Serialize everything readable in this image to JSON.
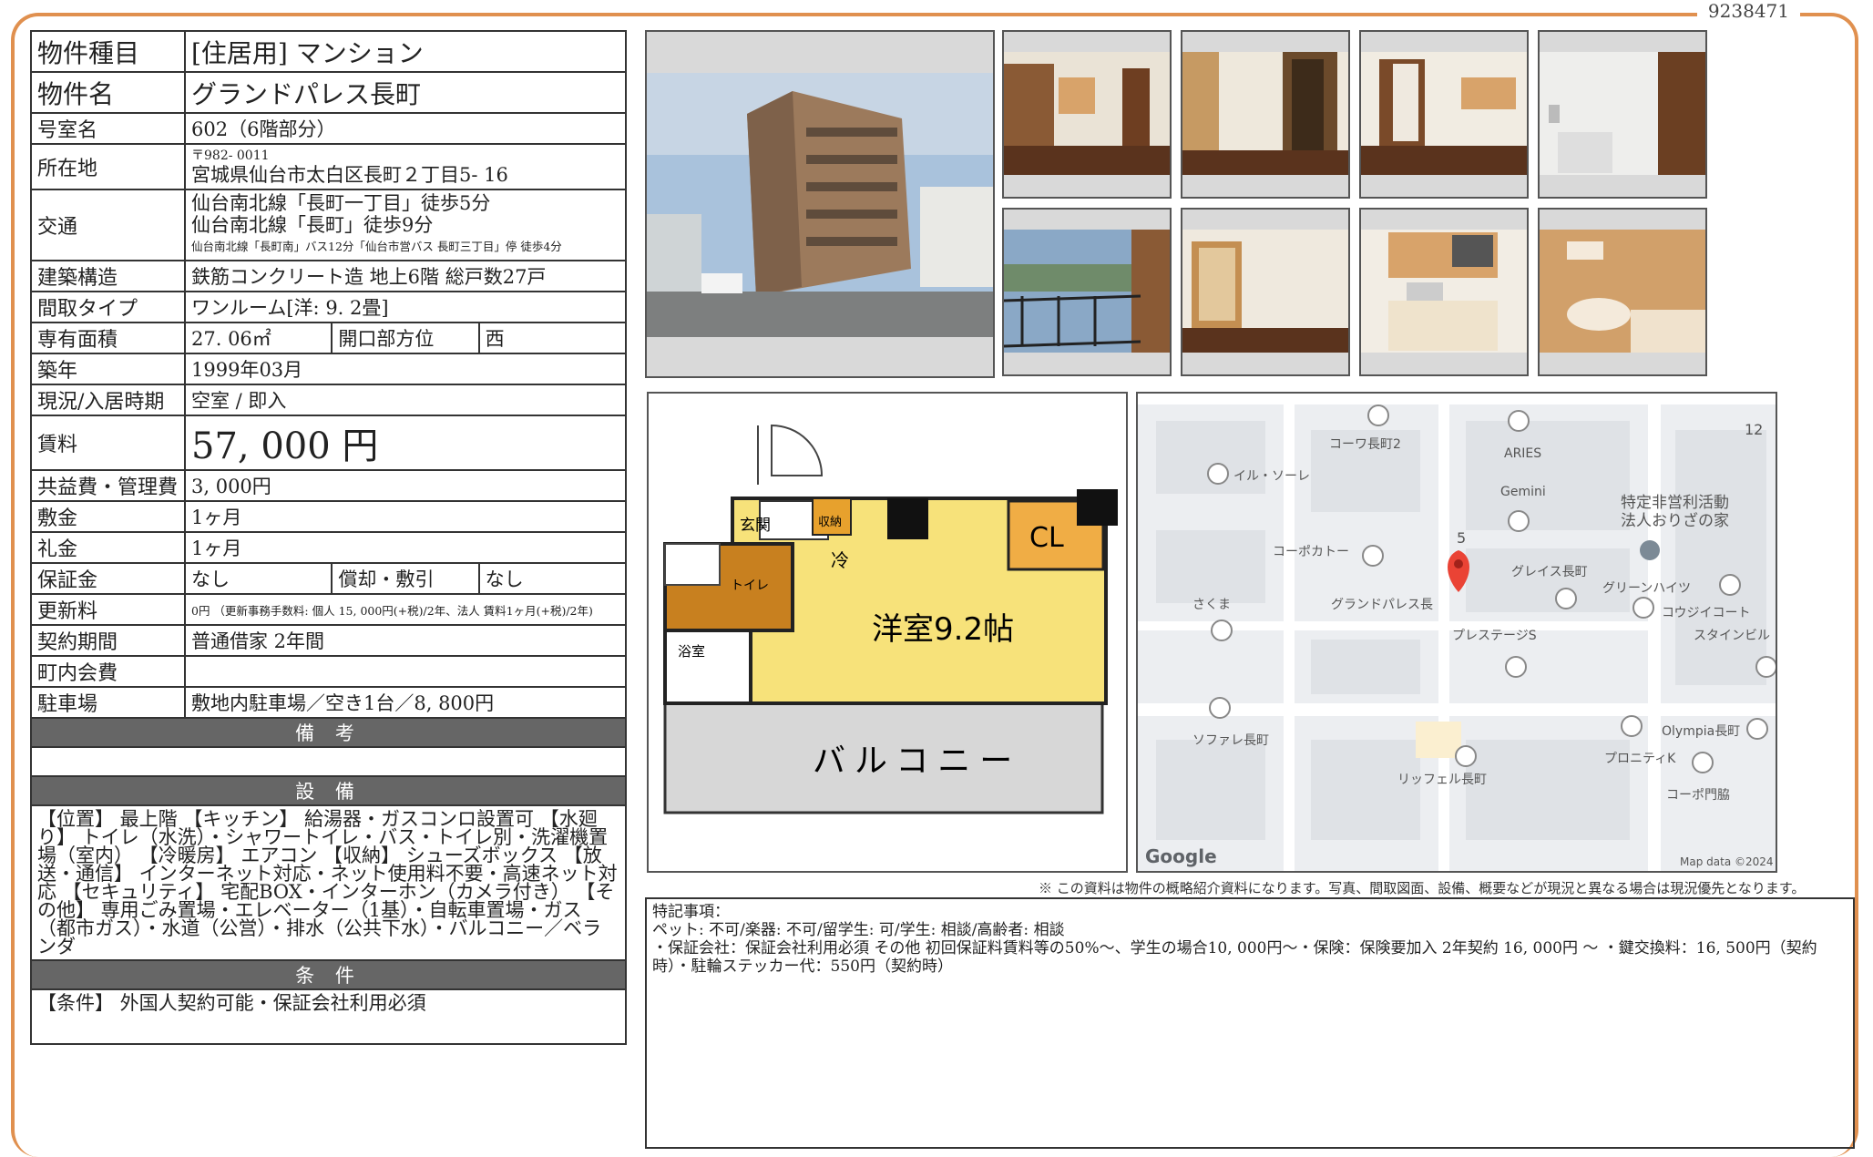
{
  "doc_id": "9238471",
  "spec": {
    "type_label": "物件種目",
    "type_value": "[住居用]  マンション",
    "name_label": "物件名",
    "name_value": "グランドパレス長町",
    "room_label": "号室名",
    "room_value": "602（6階部分）",
    "address_label": "所在地",
    "postal": "〒982- 0011",
    "address_value": "宮城県仙台市太白区長町２丁目5- 16",
    "access_label": "交通",
    "access_1": "仙台南北線「長町一丁目」徒歩5分",
    "access_2": "仙台南北線「長町」徒歩9分",
    "access_3": "仙台南北線「長町南」バス12分「仙台市営バス  長町三丁目」停  徒歩4分",
    "structure_label": "建築構造",
    "structure_value": "鉄筋コンクリート造  地上6階  総戸数27戸",
    "layout_label": "間取タイプ",
    "layout_value": "ワンルーム[洋: 9. 2畳]",
    "area_label": "専有面積",
    "area_value": "27. 06㎡",
    "facing_label": "開口部方位",
    "facing_value": "西",
    "built_label": "築年",
    "built_value": "1999年03月",
    "status_label": "現況/入居時期",
    "status_value": "空室  /  即入",
    "rent_label": "賃料",
    "rent_value": "57, 000  円",
    "fee_label": "共益費・管理費",
    "fee_value": "3, 000円",
    "deposit_label": "敷金",
    "deposit_value": "1ヶ月",
    "key_label": "礼金",
    "key_value": "1ヶ月",
    "guarantee_label": "保証金",
    "guarantee_value": "なし",
    "amort_label": "償却・敷引",
    "amort_value": "なし",
    "renewal_label": "更新料",
    "renewal_value": "0円  （更新事務手数料: 個人  15, 000円(+税)/2年、法人  賃料1ヶ月(+税)/2年)",
    "contract_label": "契約期間",
    "contract_value": "普通借家  2年間",
    "assoc_label": "町内会費",
    "assoc_value": "",
    "parking_label": "駐車場",
    "parking_value": "敷地内駐車場／空き1台／8, 800円",
    "remarks_header": "備 考",
    "equipment_header": "設 備",
    "equipment_text": "【位置】 最上階 【キッチン】 給湯器・ガスコンロ設置可 【水廻り】 トイレ（水洗）・シャワートイレ・バス・トイレ別・洗濯機置場（室内） 【冷暖房】 エアコン 【収納】 シューズボックス 【放送・通信】 インターネット対応・ネット使用料不要・高速ネット対応 【セキュリティ】 宅配BOX・インターホン（カメラ付き） 【その他】 専用ごみ置場・エレベーター（1基）・自転車置場・ガス（都市ガス）・水道（公営）・排水（公共下水）・バルコニー／ベランダ",
    "conditions_header": "条 件",
    "conditions_text": "【条件】 外国人契約可能・保証会社利用必須"
  },
  "floorplan": {
    "genkan": "玄関",
    "storage": "収納",
    "toilet": "トイレ",
    "fridge": "冷",
    "cl": "CL",
    "room": "洋室9.2帖",
    "bath": "浴室",
    "balcony": "バルコニー"
  },
  "map": {
    "labels": [
      "コーワ長町2",
      "ARIES",
      "イル・ソーレ",
      "Gemini",
      "特定非営利活動",
      "法人おりざの家",
      "コーポカトー",
      "5",
      "グレイス長町",
      "グリーンハイツ",
      "さくま",
      "グランドパレス長",
      "コウジイコート",
      "プレステージS",
      "スタインビル",
      "ソファレ長町",
      "Olympia長町",
      "プロニティK",
      "リッフェル長町",
      "コーポ門脇",
      "12"
    ],
    "google": "Google",
    "attribution": "Map data ©2024"
  },
  "disclaimer": "※ この資料は物件の概略紹介資料になります。写真、間取図面、設備、概要などが現況と異なる場合は現況優先となります。",
  "special": {
    "title": "特記事項：",
    "line1": "ペット: 不可/楽器: 不可/留学生: 可/学生: 相談/高齢者: 相談",
    "line2": "・保証会社：保証会社利用必須  その他  初回保証料賃料等の50%〜、学生の場合10, 000円〜・保険：保険要加入  2年契約  16, 000円  〜  ・鍵交換料：16, 500円（契約時）・駐輪ステッカー代：550円（契約時）"
  }
}
